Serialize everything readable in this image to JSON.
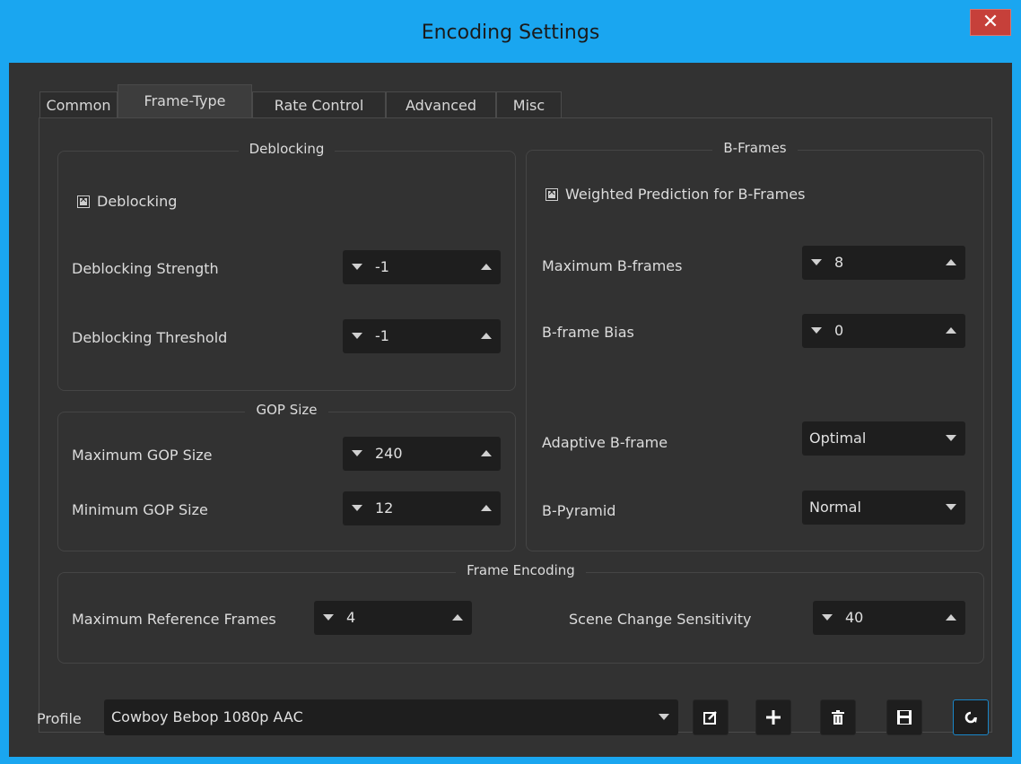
{
  "window": {
    "title": "Encoding Settings",
    "close_glyph": "✕"
  },
  "tabs": [
    {
      "label": "Common"
    },
    {
      "label": "Frame-Type",
      "active": true
    },
    {
      "label": "Rate Control"
    },
    {
      "label": "Advanced"
    },
    {
      "label": "Misc"
    }
  ],
  "deblocking": {
    "title": "Deblocking",
    "enable_label": "Deblocking",
    "enabled": true,
    "strength_label": "Deblocking Strength",
    "strength_value": "-1",
    "threshold_label": "Deblocking Threshold",
    "threshold_value": "-1"
  },
  "gop": {
    "title": "GOP Size",
    "max_label": "Maximum GOP Size",
    "max_value": "240",
    "min_label": "Minimum GOP Size",
    "min_value": "12"
  },
  "bframes": {
    "title": "B-Frames",
    "weighted_label": "Weighted Prediction for B-Frames",
    "weighted_enabled": true,
    "max_label": "Maximum B-frames",
    "max_value": "8",
    "bias_label": "B-frame Bias",
    "bias_value": "0",
    "adaptive_label": "Adaptive B-frame",
    "adaptive_value": "Optimal",
    "pyramid_label": "B-Pyramid",
    "pyramid_value": "Normal"
  },
  "frame_encoding": {
    "title": "Frame Encoding",
    "ref_label": "Maximum Reference Frames",
    "ref_value": "4",
    "scene_label": "Scene Change Sensitivity",
    "scene_value": "40"
  },
  "profile": {
    "label": "Profile",
    "value": "Cowboy Bebop 1080p AAC",
    "buttons": [
      "edit-icon",
      "add-icon",
      "trash-icon",
      "save-icon",
      "refresh-icon"
    ]
  },
  "colors": {
    "accent": "#1aa6f0",
    "background": "#323232",
    "field": "#1e1e1e",
    "close": "#c6403a"
  }
}
